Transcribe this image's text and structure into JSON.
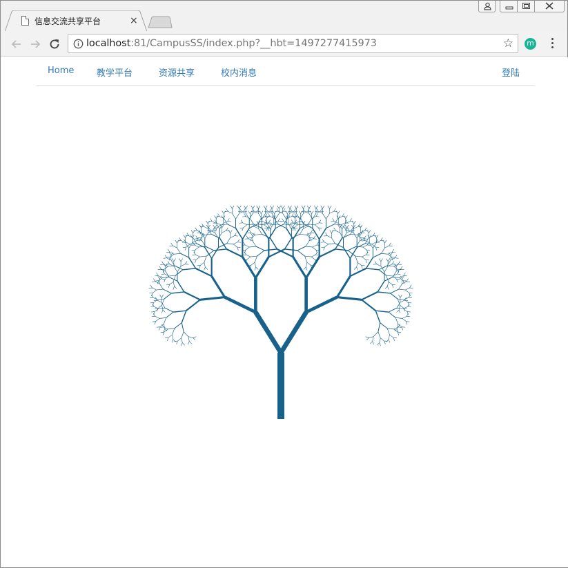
{
  "browser": {
    "tab_title": "信息交流共享平台",
    "tab_close": "×",
    "url_host": "localhost",
    "url_rest": ":81/CampusSS/index.php?__hbt=1497277415973",
    "extension_letter": "m"
  },
  "navbar": {
    "links": [
      "Home",
      "教学平台",
      "资源共享",
      "校内消息"
    ],
    "login": "登陆"
  },
  "tree": {
    "color": "#17618a"
  },
  "icons": {
    "tab_favicon": "page-icon",
    "back": "back-arrow-icon",
    "forward": "forward-arrow-icon",
    "reload": "reload-icon",
    "info": "info-icon",
    "star": "bookmark-star-icon",
    "menu": "menu-dots-icon"
  }
}
